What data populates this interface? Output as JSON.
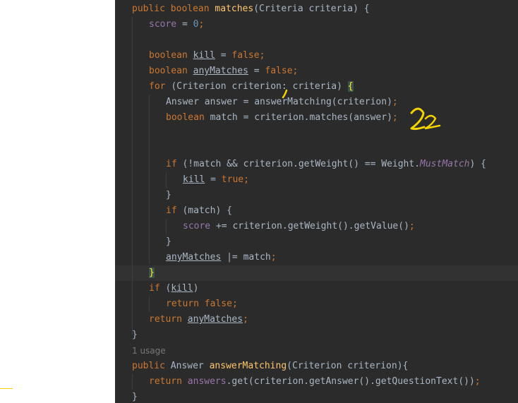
{
  "code": {
    "l1": {
      "a": "public ",
      "b": "boolean ",
      "c": "matches",
      "d": "(Criteria criteria) {"
    },
    "l2": {
      "a": "score",
      "b": " = ",
      "c": "0",
      "d": ";"
    },
    "l3": {
      "a": "boolean ",
      "b": "kill",
      "c": " = ",
      "d": "false",
      "e": ";"
    },
    "l4": {
      "a": "boolean ",
      "b": "anyMatches",
      "c": " = ",
      "d": "false",
      "e": ";"
    },
    "l5": {
      "a": "for ",
      "b": "(Criterion criterion",
      "c": ": criteria) ",
      "d": "{"
    },
    "l6": {
      "a": "Answer answer = answerMatching(criterion)",
      "b": ";"
    },
    "l7": {
      "a": "boolean ",
      "b": "match = criterion.matches(answer)",
      "c": ";"
    },
    "l8": {
      "a": "if ",
      "b": "(!match && criterion.getWeight() == Weight.",
      "c": "MustMatch",
      "d": ") {"
    },
    "l9": {
      "a": "kill",
      "b": " = ",
      "c": "true",
      "d": ";"
    },
    "l10": {
      "a": "}"
    },
    "l11": {
      "a": "if ",
      "b": "(match) {"
    },
    "l12": {
      "a": "score",
      "b": " += criterion.getWeight().getValue()",
      "c": ";"
    },
    "l13": {
      "a": "}"
    },
    "l14": {
      "a": "anyMatches",
      "b": " |= match",
      "c": ";"
    },
    "l15": {
      "a": "}"
    },
    "l16": {
      "a": "if ",
      "b": "(",
      "c": "kill",
      "d": ")"
    },
    "l17": {
      "a": "return ",
      "b": "false",
      "c": ";"
    },
    "l18": {
      "a": "return ",
      "b": "anyMatches",
      "c": ";"
    },
    "l19": {
      "a": "}"
    },
    "usage": "1 usage",
    "l20": {
      "a": "public ",
      "b": "Answer ",
      "c": "answerMatching",
      "d": "(Criterion criterion){"
    },
    "l21": {
      "a": "return ",
      "b": "answers",
      "c": ".get(criterion.getAnswer().getQuestionText())",
      "d": ";"
    },
    "l22": {
      "a": "}"
    }
  },
  "colors": {
    "editor_bg": "#2b2b2b",
    "keyword": "#cc7832",
    "method": "#ffc66d",
    "field": "#9876aa",
    "number": "#6897bb",
    "text": "#a9b7c6",
    "annotation": "#f5d300"
  }
}
